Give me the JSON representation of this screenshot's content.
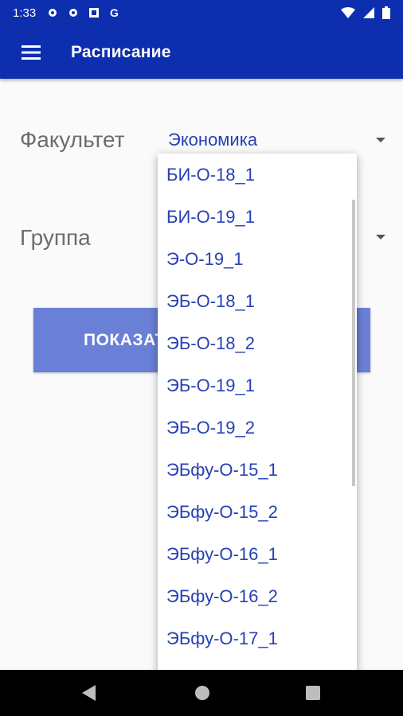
{
  "status_bar": {
    "time": "1:33",
    "left_icons": [
      "gear-icon",
      "gear-icon",
      "notification-box-icon",
      "google-g-icon"
    ],
    "right_icons": [
      "wifi-icon",
      "signal-icon",
      "battery-icon"
    ]
  },
  "app_bar": {
    "title": "Расписание",
    "background": "#0d2eae"
  },
  "form": {
    "faculty_label": "Факультет",
    "faculty_value": "Экономика",
    "group_label": "Группа",
    "show_button_label": "ПОКАЗАТЬ"
  },
  "dropdown": {
    "items": [
      "БИ-О-18_1",
      "БИ-О-19_1",
      "Э-О-19_1",
      "ЭБ-О-18_1",
      "ЭБ-О-18_2",
      "ЭБ-О-19_1",
      "ЭБ-О-19_2",
      "ЭБфу-О-15_1",
      "ЭБфу-О-15_2",
      "ЭБфу-О-16_1",
      "ЭБфу-О-16_2",
      "ЭБфу-О-17_1"
    ]
  },
  "colors": {
    "accent": "#0d2eae",
    "item_text": "#2740b5",
    "button": "#6a7fd6"
  }
}
